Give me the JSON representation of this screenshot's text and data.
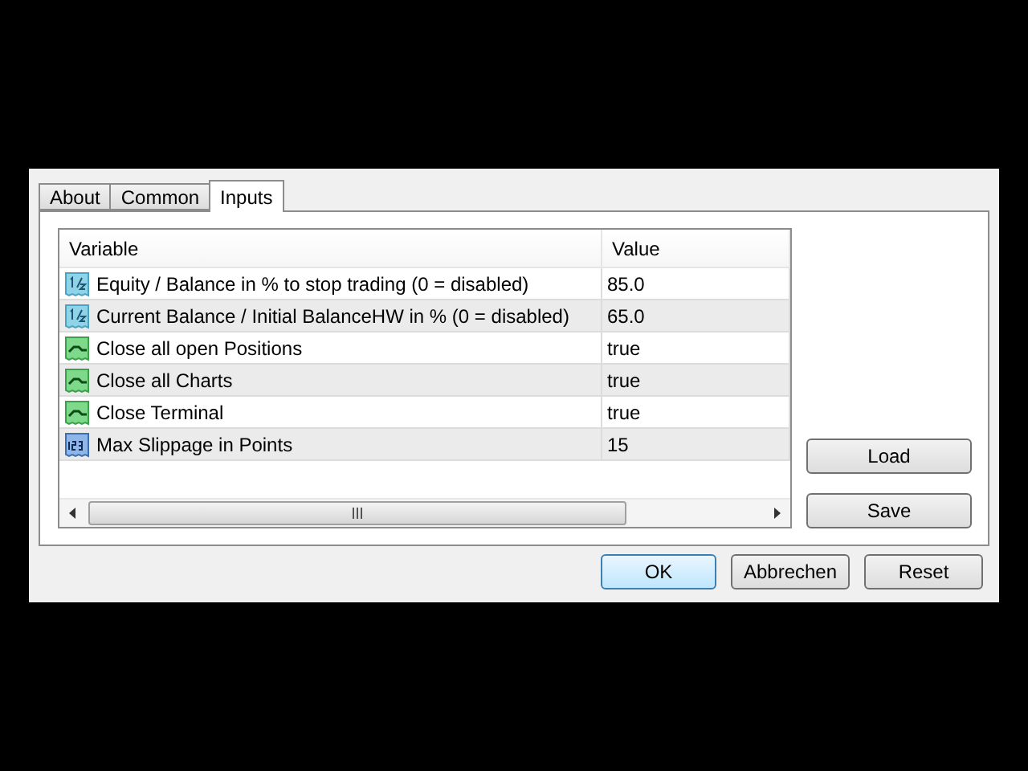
{
  "tabs": [
    {
      "label": "About",
      "selected": false
    },
    {
      "label": "Common",
      "selected": false
    },
    {
      "label": "Inputs",
      "selected": true
    }
  ],
  "table": {
    "columns": [
      "Variable",
      "Value"
    ],
    "rows": [
      {
        "kind": "double",
        "variable": "Equity / Balance in % to stop trading (0 = disabled)",
        "value": "85.0"
      },
      {
        "kind": "double",
        "variable": "Current Balance / Initial BalanceHW in % (0 = disabled)",
        "value": "65.0"
      },
      {
        "kind": "bool",
        "variable": "Close all open Positions",
        "value": "true"
      },
      {
        "kind": "bool",
        "variable": "Close all Charts",
        "value": "true"
      },
      {
        "kind": "bool",
        "variable": "Close Terminal",
        "value": "true"
      },
      {
        "kind": "int",
        "variable": "Max Slippage in Points",
        "value": "15"
      }
    ]
  },
  "side_buttons": [
    "Load",
    "Save"
  ],
  "buttons": [
    {
      "label": "OK",
      "default": true
    },
    {
      "label": "Abbrechen",
      "default": false
    },
    {
      "label": "Reset",
      "default": false
    }
  ]
}
